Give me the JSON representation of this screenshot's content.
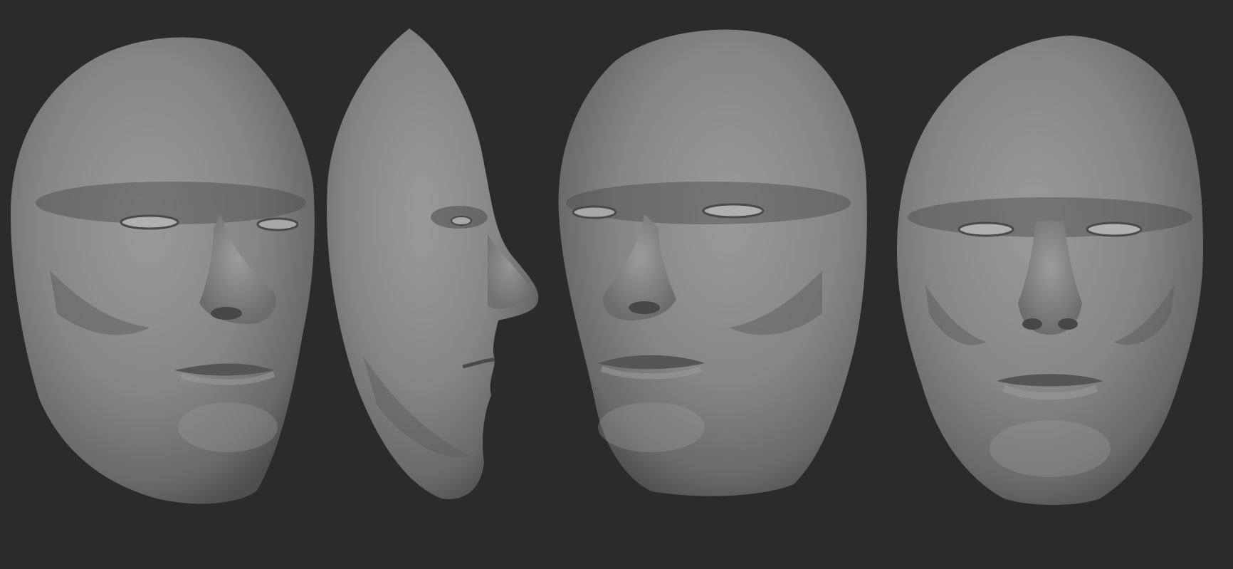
{
  "scene": {
    "background_color": "#2b2b2b",
    "material_color": "#8a8a8a",
    "views": [
      {
        "id": "three-quarter-left",
        "label": ""
      },
      {
        "id": "profile",
        "label": ""
      },
      {
        "id": "three-quarter-right",
        "label": ""
      },
      {
        "id": "front",
        "label": ""
      }
    ]
  }
}
